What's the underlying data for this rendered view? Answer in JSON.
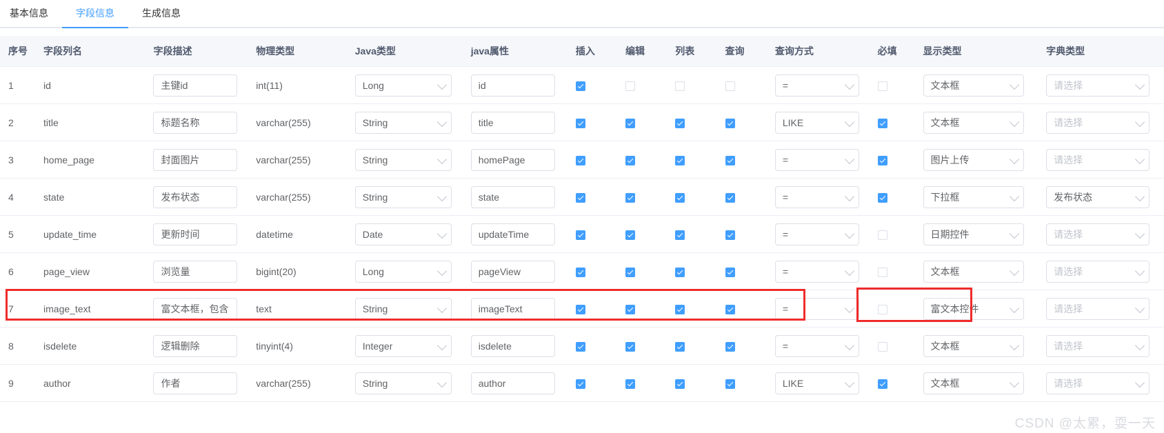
{
  "tabs": [
    {
      "label": "基本信息",
      "active": false
    },
    {
      "label": "字段信息",
      "active": true
    },
    {
      "label": "生成信息",
      "active": false
    }
  ],
  "table": {
    "headers": [
      "序号",
      "字段列名",
      "字段描述",
      "物理类型",
      "Java类型",
      "java属性",
      "插入",
      "编辑",
      "列表",
      "查询",
      "查询方式",
      "必填",
      "显示类型",
      "字典类型"
    ],
    "dict_placeholder": "请选择",
    "rows": [
      {
        "index": "1",
        "column": "id",
        "desc": "主键id",
        "physical": "int(11)",
        "java_type": "Long",
        "java_attr": "id",
        "insert": true,
        "edit": false,
        "list": false,
        "query": false,
        "query_type": "=",
        "required": false,
        "show_type": "文本框",
        "dict_type": "请选择",
        "dict_empty": true
      },
      {
        "index": "2",
        "column": "title",
        "desc": "标题名称",
        "physical": "varchar(255)",
        "java_type": "String",
        "java_attr": "title",
        "insert": true,
        "edit": true,
        "list": true,
        "query": true,
        "query_type": "LIKE",
        "required": true,
        "show_type": "文本框",
        "dict_type": "请选择",
        "dict_empty": true
      },
      {
        "index": "3",
        "column": "home_page",
        "desc": "封面图片",
        "physical": "varchar(255)",
        "java_type": "String",
        "java_attr": "homePage",
        "insert": true,
        "edit": true,
        "list": true,
        "query": true,
        "query_type": "=",
        "required": true,
        "show_type": "图片上传",
        "dict_type": "请选择",
        "dict_empty": true
      },
      {
        "index": "4",
        "column": "state",
        "desc": "发布状态",
        "physical": "varchar(255)",
        "java_type": "String",
        "java_attr": "state",
        "insert": true,
        "edit": true,
        "list": true,
        "query": true,
        "query_type": "=",
        "required": true,
        "show_type": "下拉框",
        "dict_type": "发布状态",
        "dict_empty": false
      },
      {
        "index": "5",
        "column": "update_time",
        "desc": "更新时间",
        "physical": "datetime",
        "java_type": "Date",
        "java_attr": "updateTime",
        "insert": true,
        "edit": true,
        "list": true,
        "query": true,
        "query_type": "=",
        "required": false,
        "show_type": "日期控件",
        "dict_type": "请选择",
        "dict_empty": true
      },
      {
        "index": "6",
        "column": "page_view",
        "desc": "浏览量",
        "physical": "bigint(20)",
        "java_type": "Long",
        "java_attr": "pageView",
        "insert": true,
        "edit": true,
        "list": true,
        "query": true,
        "query_type": "=",
        "required": false,
        "show_type": "文本框",
        "dict_type": "请选择",
        "dict_empty": true
      },
      {
        "index": "7",
        "column": "image_text",
        "desc": "富文本框，包含",
        "physical": "text",
        "java_type": "String",
        "java_attr": "imageText",
        "insert": true,
        "edit": true,
        "list": true,
        "query": true,
        "query_type": "=",
        "required": false,
        "show_type": "富文本控件",
        "dict_type": "请选择",
        "dict_empty": true
      },
      {
        "index": "8",
        "column": "isdelete",
        "desc": "逻辑删除",
        "physical": "tinyint(4)",
        "java_type": "Integer",
        "java_attr": "isdelete",
        "insert": true,
        "edit": true,
        "list": true,
        "query": true,
        "query_type": "=",
        "required": false,
        "show_type": "文本框",
        "dict_type": "请选择",
        "dict_empty": true
      },
      {
        "index": "9",
        "column": "author",
        "desc": "作者",
        "physical": "varchar(255)",
        "java_type": "String",
        "java_attr": "author",
        "insert": true,
        "edit": true,
        "list": true,
        "query": true,
        "query_type": "LIKE",
        "required": true,
        "show_type": "文本框",
        "dict_type": "请选择",
        "dict_empty": true
      }
    ]
  },
  "annotations": {
    "highlight_row_index": "7",
    "highlight_color": "#f02b2b"
  },
  "watermark": "CSDN @太累，耍一天"
}
